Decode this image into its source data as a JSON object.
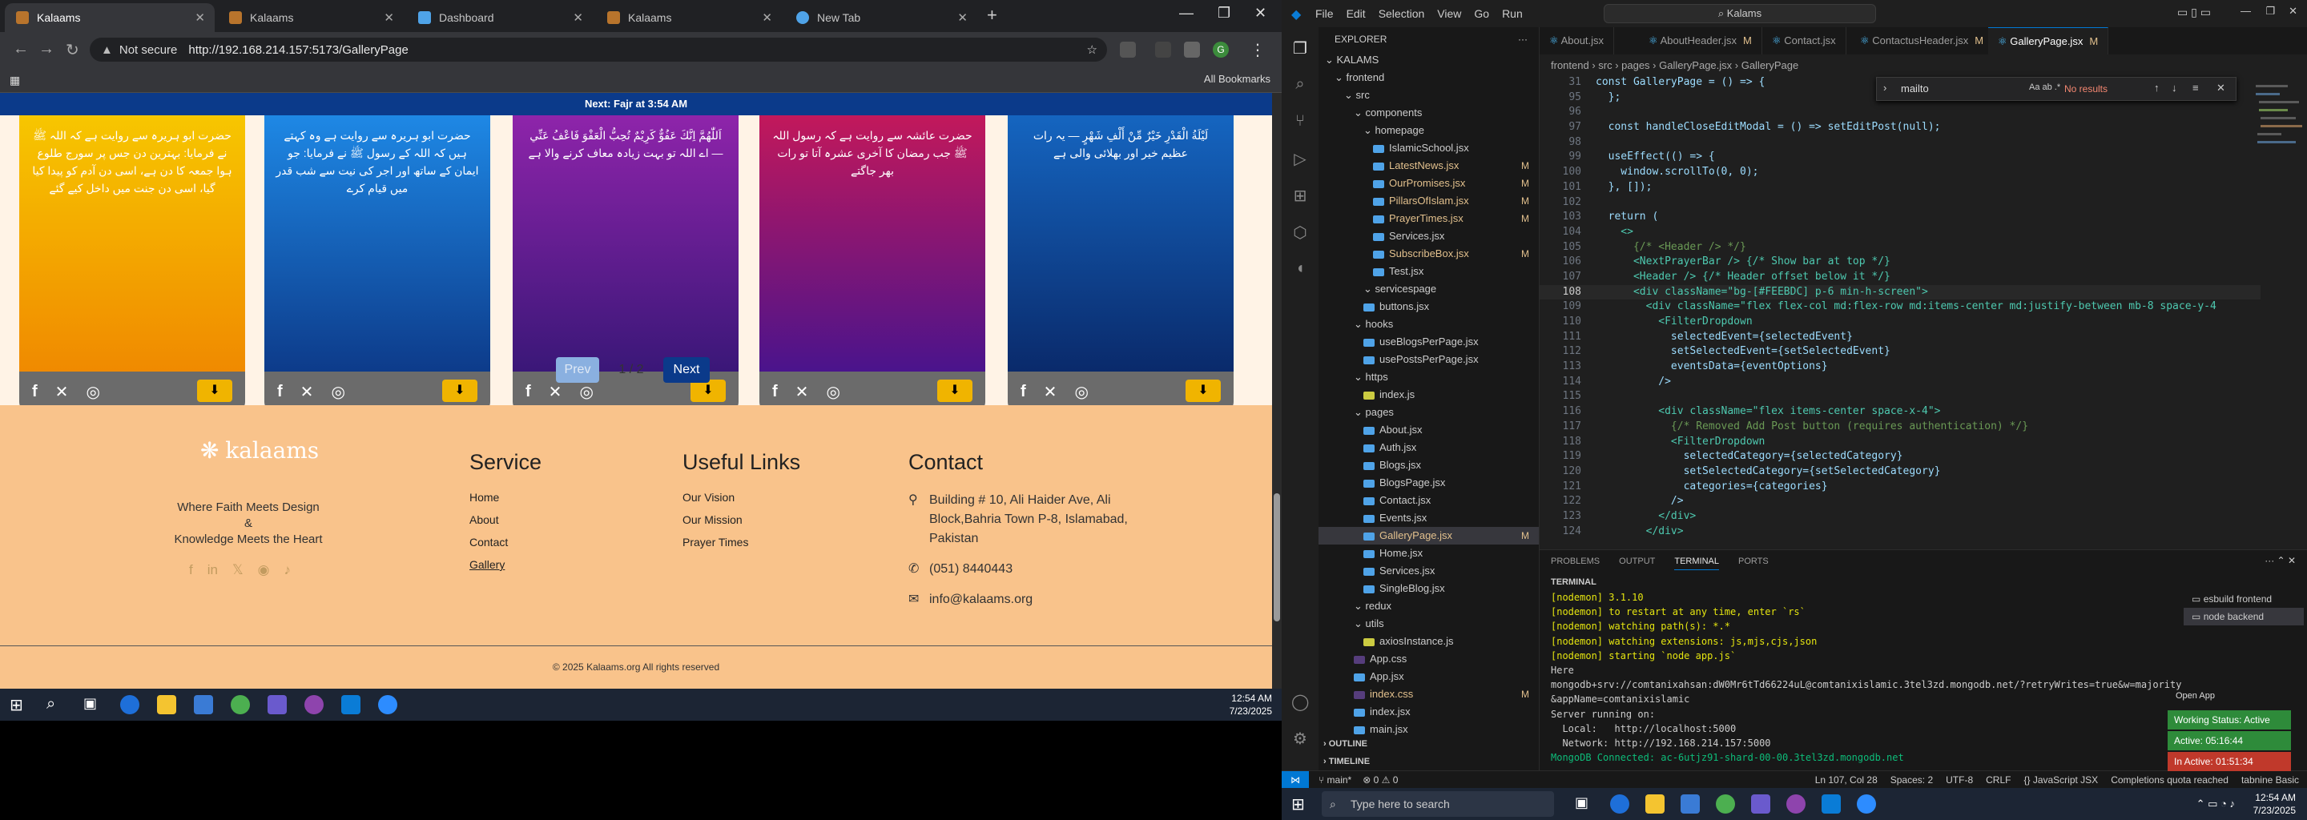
{
  "chrome": {
    "tabs": [
      {
        "label": "Kalaams",
        "active": true
      },
      {
        "label": "Kalaams",
        "active": false
      },
      {
        "label": "Dashboard",
        "active": false
      },
      {
        "label": "Kalaams",
        "active": false
      },
      {
        "label": "New Tab",
        "active": false
      }
    ],
    "security_label": "Not secure",
    "url": "http://192.168.214.157:5173/GalleryPage",
    "all_bookmarks": "All Bookmarks",
    "profile_initial": "G"
  },
  "site": {
    "prayer_bar": "Next: Fajr at 3:54 AM",
    "cards": [
      {
        "text": "حضرت ابو ہریرہ سے روایت ہے کہ اللہ ﷺ نے فرمایا: بہترین دن جس پر سورج طلوع ہوا جمعہ کا دن ہے، اسی دن آدم کو پیدا کیا گیا، اسی دن جنت میں داخل کیے گئے",
        "colors": [
          "#f7c600",
          "#f08a00"
        ]
      },
      {
        "text": "حضرت ابو ہریرہ سے روایت ہے وہ کہتے ہیں کہ اللہ کے رسول ﷺ نے فرمایا: جو ایمان کے ساتھ اور اجر کی نیت سے شب قدر میں قیام کرے",
        "colors": [
          "#1e88e5",
          "#0d3b8a"
        ]
      },
      {
        "text": "اَللّٰهُمَّ اِنَّكَ عَفُوٌّ كَرِيْمٌ تُحِبُّ الْعَفْوَ فَاعْفُ عَنِّي — اے اللہ تو بہت زیادہ معاف کرنے والا ہے",
        "colors": [
          "#8e24aa",
          "#3a1778"
        ]
      },
      {
        "text": "حضرت عائشہ سے روایت ہے کہ رسول اللہ ﷺ جب رمضان کا آخری عشرہ آتا تو رات بھر جاگتے",
        "colors": [
          "#c2185b",
          "#4a148c"
        ]
      },
      {
        "text": "لَيْلَةُ الْقَدْرِ خَيْرٌ مِّنْ أَلْفِ شَهْرٍ — یہ رات عظیم خیر اور بھلائی والی ہے",
        "colors": [
          "#1565c0",
          "#0a2a6b"
        ]
      }
    ],
    "pager": {
      "prev": "Prev",
      "count": "1 / 2",
      "next": "Next"
    },
    "footer": {
      "logo": "kalaams",
      "tagline_1": "Where Faith Meets Design",
      "tagline_amp": "&",
      "tagline_2": "Knowledge Meets the Heart",
      "service_title": "Service",
      "service_links": [
        "Home",
        "About",
        "Contact",
        "Gallery"
      ],
      "useful_title": "Useful Links",
      "useful_links": [
        "Our Vision",
        "Our Mission",
        "Prayer Times"
      ],
      "contact_title": "Contact",
      "address": "Building # 10, Ali Haider Ave, Ali Block,Bahria Town P-8, Islamabad, Pakistan",
      "phone": "(051) 8440443",
      "email": "info@kalaams.org",
      "copyright": "© 2025 Kalaams.org All rights reserved"
    }
  },
  "taskbar_left": {
    "time": "12:54 AM",
    "date": "7/23/2025"
  },
  "vscode": {
    "menu": [
      "File",
      "Edit",
      "Selection",
      "View",
      "Go",
      "Run"
    ],
    "search": "Kalams",
    "explorer_title": "EXPLORER",
    "tree": [
      {
        "label": "KALAMS",
        "indent": 0,
        "folder": true
      },
      {
        "label": "frontend",
        "indent": 1,
        "folder": true
      },
      {
        "label": "src",
        "indent": 2,
        "folder": true
      },
      {
        "label": "components",
        "indent": 3,
        "folder": true
      },
      {
        "label": "homepage",
        "indent": 4,
        "folder": true
      },
      {
        "label": "IslamicSchool.jsx",
        "indent": 5
      },
      {
        "label": "LatestNews.jsx",
        "indent": 5,
        "mod": "M"
      },
      {
        "label": "OurPromises.jsx",
        "indent": 5,
        "mod": "M"
      },
      {
        "label": "PillarsOfIslam.jsx",
        "indent": 5,
        "mod": "M"
      },
      {
        "label": "PrayerTimes.jsx",
        "indent": 5,
        "mod": "M"
      },
      {
        "label": "Services.jsx",
        "indent": 5
      },
      {
        "label": "SubscribeBox.jsx",
        "indent": 5,
        "mod": "M"
      },
      {
        "label": "Test.jsx",
        "indent": 5
      },
      {
        "label": "servicespage",
        "indent": 4,
        "folder": true
      },
      {
        "label": "buttons.jsx",
        "indent": 4
      },
      {
        "label": "hooks",
        "indent": 3,
        "folder": true
      },
      {
        "label": "useBlogsPerPage.jsx",
        "indent": 4
      },
      {
        "label": "usePostsPerPage.jsx",
        "indent": 4
      },
      {
        "label": "https",
        "indent": 3,
        "folder": true
      },
      {
        "label": "index.js",
        "indent": 4
      },
      {
        "label": "pages",
        "indent": 3,
        "folder": true
      },
      {
        "label": "About.jsx",
        "indent": 4
      },
      {
        "label": "Auth.jsx",
        "indent": 4
      },
      {
        "label": "Blogs.jsx",
        "indent": 4
      },
      {
        "label": "BlogsPage.jsx",
        "indent": 4
      },
      {
        "label": "Contact.jsx",
        "indent": 4
      },
      {
        "label": "Events.jsx",
        "indent": 4
      },
      {
        "label": "GalleryPage.jsx",
        "indent": 4,
        "mod": "M",
        "sel": true
      },
      {
        "label": "Home.jsx",
        "indent": 4
      },
      {
        "label": "Services.jsx",
        "indent": 4
      },
      {
        "label": "SingleBlog.jsx",
        "indent": 4
      },
      {
        "label": "redux",
        "indent": 3,
        "folder": true
      },
      {
        "label": "utils",
        "indent": 3,
        "folder": true
      },
      {
        "label": "axiosInstance.js",
        "indent": 4
      },
      {
        "label": "App.css",
        "indent": 3
      },
      {
        "label": "App.jsx",
        "indent": 3
      },
      {
        "label": "index.css",
        "indent": 3,
        "mod": "M"
      },
      {
        "label": "index.jsx",
        "indent": 3
      },
      {
        "label": "main.jsx",
        "indent": 3
      }
    ],
    "outline": "OUTLINE",
    "timeline": "TIMELINE",
    "editor_tabs": [
      {
        "label": "About.jsx"
      },
      {
        "label": "AboutHeader.jsx",
        "mod": "M"
      },
      {
        "label": "Contact.jsx"
      },
      {
        "label": "ContactusHeader.jsx",
        "mod": "M"
      },
      {
        "label": "GalleryPage.jsx",
        "mod": "M",
        "active": true
      }
    ],
    "breadcrumb": "frontend › src › pages › GalleryPage.jsx › GalleryPage",
    "find_query": "mailto",
    "find_result": "No results",
    "code": [
      {
        "n": "31",
        "t": "const GalleryPage = () => {"
      },
      {
        "n": "95",
        "t": "  };"
      },
      {
        "n": "96",
        "t": ""
      },
      {
        "n": "97",
        "t": "  const handleCloseEditModal = () => setEditPost(null);"
      },
      {
        "n": "98",
        "t": ""
      },
      {
        "n": "99",
        "t": "  useEffect(() => {"
      },
      {
        "n": "100",
        "t": "    window.scrollTo(0, 0);"
      },
      {
        "n": "101",
        "t": "  }, []);"
      },
      {
        "n": "102",
        "t": ""
      },
      {
        "n": "103",
        "t": "  return ("
      },
      {
        "n": "104",
        "t": "    <>"
      },
      {
        "n": "105",
        "t": "      {/* <Header /> */}"
      },
      {
        "n": "106",
        "t": "      <NextPrayerBar /> {/* Show bar at top */}"
      },
      {
        "n": "107",
        "t": "      <Header /> {/* Header offset below it */}"
      },
      {
        "n": "108",
        "t": "      <div className=\"bg-[#FEEBDC] p-6 min-h-screen\">",
        "cur": true
      },
      {
        "n": "109",
        "t": "        <div className=\"flex flex-col md:flex-row md:items-center md:justify-between mb-8 space-y-4"
      },
      {
        "n": "110",
        "t": "          <FilterDropdown"
      },
      {
        "n": "111",
        "t": "            selectedEvent={selectedEvent}"
      },
      {
        "n": "112",
        "t": "            setSelectedEvent={setSelectedEvent}"
      },
      {
        "n": "113",
        "t": "            eventsData={eventOptions}"
      },
      {
        "n": "114",
        "t": "          />"
      },
      {
        "n": "115",
        "t": ""
      },
      {
        "n": "116",
        "t": "          <div className=\"flex items-center space-x-4\">"
      },
      {
        "n": "117",
        "t": "            {/* Removed Add Post button (requires authentication) */}"
      },
      {
        "n": "118",
        "t": "            <FilterDropdown"
      },
      {
        "n": "119",
        "t": "              selectedCategory={selectedCategory}"
      },
      {
        "n": "120",
        "t": "              setSelectedCategory={setSelectedCategory}"
      },
      {
        "n": "121",
        "t": "              categories={categories}"
      },
      {
        "n": "122",
        "t": "            />"
      },
      {
        "n": "123",
        "t": "          </div>"
      },
      {
        "n": "124",
        "t": "        </div>"
      }
    ],
    "panel_tabs": [
      "PROBLEMS",
      "OUTPUT",
      "TERMINAL",
      "PORTS"
    ],
    "terminal_title": "TERMINAL",
    "terminal": [
      "[nodemon] 3.1.10",
      "[nodemon] to restart at any time, enter `rs`",
      "[nodemon] watching path(s): *.*",
      "[nodemon] watching extensions: js,mjs,cjs,json",
      "[nodemon] starting `node app.js`",
      "Here",
      "mongodb+srv://comtanixahsan:dW0Mr6tTd66224uL@comtanixislamic.3tel3zd.mongodb.net/?retryWrites=true&w=majority",
      "&appName=comtanixislamic",
      "Server running on:",
      "  Local:   http://localhost:5000",
      "  Network: http://192.168.214.157:5000",
      "MongoDB Connected: ac-6utjz91-shard-00-00.3tel3zd.mongodb.net"
    ],
    "terminal_list": [
      "esbuild frontend",
      "node backend"
    ],
    "open_app": "Open App",
    "work_status": [
      "Working Status: Active",
      "Active: 05:16:44",
      "In Active: 01:51:34"
    ],
    "status": {
      "branch": "main*",
      "problems": "⊗ 0 ⚠ 0",
      "position": "Ln 107, Col 28",
      "spaces": "Spaces: 2",
      "encoding": "UTF-8",
      "eol": "CRLF",
      "lang": "{} JavaScript JSX",
      "quota": "Completions quota reached",
      "tabnine": "tabnine Basic"
    }
  },
  "taskbar_right": {
    "search": "Type here to search",
    "time": "12:54 AM",
    "date": "7/23/2025"
  }
}
